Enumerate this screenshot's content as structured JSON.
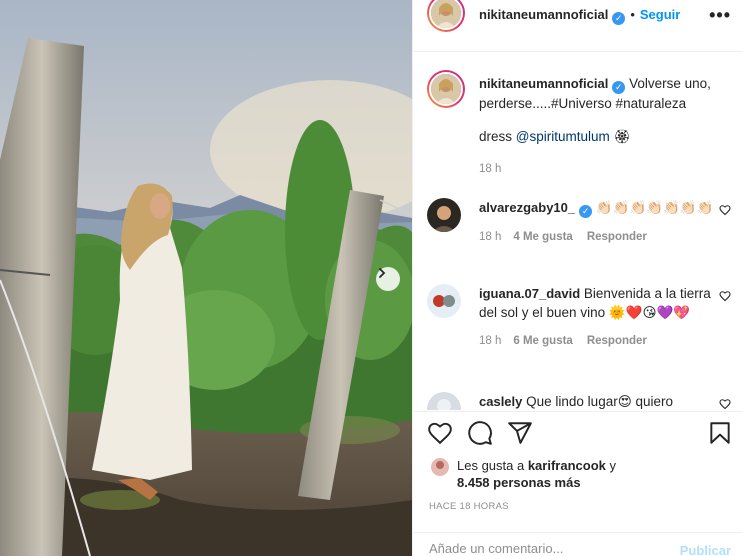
{
  "post": {
    "username": "nikitaneumannoficial",
    "follow_label": "Seguir",
    "more_label": "•••",
    "verified_glyph": "✓"
  },
  "caption": {
    "username": "nikitaneumannoficial",
    "text": "Volverse uno, perderse.....#Universo #naturaleza",
    "line2_prefix": "dress ",
    "line2_tag": "@spiritumtulum",
    "line2_emoji": "🏵",
    "time": "18 h"
  },
  "comments": [
    {
      "username": "alvarezgaby10_",
      "text": "👏🏻👏🏻👏🏻👏🏻👏🏻👏🏻👏🏻",
      "time": "18 h",
      "likes": "4 Me gusta",
      "reply": "Responder"
    },
    {
      "username": "iguana.07_david",
      "text": "Bienvenida a la tierra del sol y el buen vino 🌞❤️😘💜💖",
      "time": "18 h",
      "likes": "6 Me gusta",
      "reply": "Responder"
    },
    {
      "username": "caslely",
      "text": "Que lindo lugar😍 quiero"
    }
  ],
  "likes": {
    "prefix": "Les gusta a ",
    "user": "karifrancook",
    "suffix": " y",
    "count_line": "8.458 personas más"
  },
  "time_ago": "HACE 18 HORAS",
  "add_comment": {
    "placeholder": "Añade un comentario...",
    "publish_label": "Publicar"
  },
  "icons": [
    "heart-icon",
    "comment-icon",
    "share-icon",
    "bookmark-icon",
    "next-arrow-icon",
    "more-icon"
  ],
  "colors": {
    "accent": "#0095f6",
    "verified": "#3897f0",
    "muted": "#8e8e8e",
    "publish_disabled": "#b2dffc"
  }
}
